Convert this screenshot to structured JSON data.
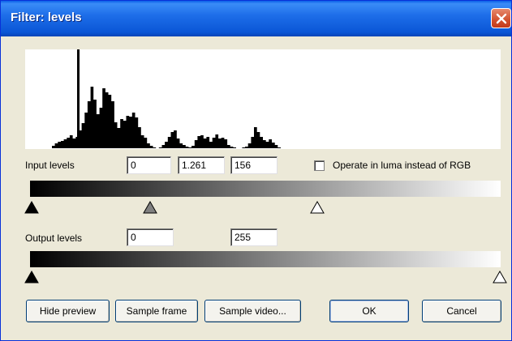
{
  "window": {
    "title": "Filter: levels"
  },
  "histogram": {
    "profile": [
      0,
      0,
      0,
      0,
      0,
      0,
      0,
      0,
      0,
      3,
      6,
      8,
      9,
      11,
      13,
      16,
      12,
      14,
      22,
      31,
      44,
      58,
      76,
      60,
      42,
      50,
      74,
      69,
      66,
      58,
      32,
      25,
      36,
      34,
      40,
      39,
      44,
      38,
      26,
      16,
      13,
      6,
      3,
      1,
      0,
      1,
      4,
      8,
      14,
      20,
      22,
      12,
      6,
      4,
      2,
      1,
      3,
      10,
      15,
      16,
      12,
      14,
      8,
      13,
      17,
      12,
      13,
      11,
      4,
      2,
      1,
      0,
      0,
      1,
      2,
      6,
      14,
      26,
      20,
      14,
      10,
      8,
      11,
      7,
      4,
      1,
      0,
      0,
      0,
      0,
      0,
      0,
      0,
      0,
      0,
      0,
      0,
      0,
      0,
      0,
      0,
      0,
      0,
      0,
      0,
      0,
      0,
      0,
      0,
      0,
      0,
      0,
      0,
      0,
      0,
      0,
      0,
      0,
      0,
      0,
      0,
      0,
      0,
      0,
      0,
      0,
      0,
      0,
      0,
      0,
      0,
      0,
      0,
      0,
      0,
      0,
      0,
      0,
      0,
      0,
      0,
      0,
      0,
      0,
      0,
      0,
      0,
      0,
      0,
      0,
      0,
      0,
      0,
      0,
      0,
      0,
      0,
      0,
      0,
      0
    ],
    "spike": 126
  },
  "input": {
    "label": "Input levels",
    "black": "0",
    "gamma": "1.261",
    "white": "156",
    "luma_label": "Operate in luma instead of RGB",
    "luma_checked": false
  },
  "output": {
    "label": "Output levels",
    "black": "0",
    "white": "255"
  },
  "buttons": {
    "hide_preview": "Hide preview",
    "sample_frame": "Sample frame",
    "sample_video": "Sample video...",
    "ok": "OK",
    "cancel": "Cancel"
  }
}
